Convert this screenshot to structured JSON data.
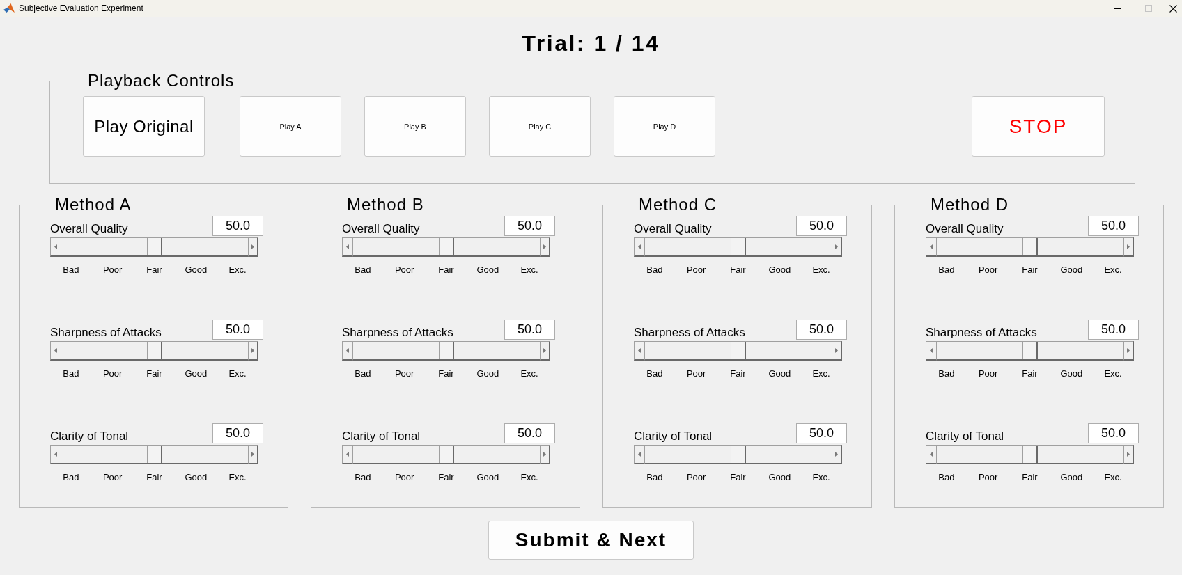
{
  "window": {
    "title": "Subjective Evaluation Experiment",
    "controls": [
      {
        "kind": "minimize",
        "disabled": false
      },
      {
        "kind": "maximize",
        "disabled": true
      },
      {
        "kind": "close",
        "disabled": false
      }
    ]
  },
  "trial_heading": "Trial: 1 / 14",
  "playback_controls": {
    "title": "Playback Controls",
    "buttons": [
      {
        "label": "Play Original",
        "kind": "large"
      },
      {
        "label": "Play A",
        "kind": "small"
      },
      {
        "label": "Play B",
        "kind": "small"
      },
      {
        "label": "Play C",
        "kind": "small"
      },
      {
        "label": "Play D",
        "kind": "small"
      },
      {
        "label": "STOP",
        "kind": "stop"
      }
    ]
  },
  "methods": [
    {
      "title": "Method A",
      "criteria": [
        {
          "label": "Overall Quality",
          "value": "50.0",
          "level": 0.5,
          "scale": [
            "Bad",
            "Poor",
            "Fair",
            "Good",
            "Exc."
          ]
        },
        {
          "label": "Sharpness of Attacks",
          "value": "50.0",
          "level": 0.5,
          "scale": [
            "Bad",
            "Poor",
            "Fair",
            "Good",
            "Exc."
          ]
        },
        {
          "label": "Clarity of Tonal",
          "value": "50.0",
          "level": 0.5,
          "scale": [
            "Bad",
            "Poor",
            "Fair",
            "Good",
            "Exc."
          ]
        }
      ]
    },
    {
      "title": "Method B",
      "criteria": [
        {
          "label": "Overall Quality",
          "value": "50.0",
          "level": 0.5,
          "scale": [
            "Bad",
            "Poor",
            "Fair",
            "Good",
            "Exc."
          ]
        },
        {
          "label": "Sharpness of Attacks",
          "value": "50.0",
          "level": 0.5,
          "scale": [
            "Bad",
            "Poor",
            "Fair",
            "Good",
            "Exc."
          ]
        },
        {
          "label": "Clarity of Tonal",
          "value": "50.0",
          "level": 0.5,
          "scale": [
            "Bad",
            "Poor",
            "Fair",
            "Good",
            "Exc."
          ]
        }
      ]
    },
    {
      "title": "Method C",
      "criteria": [
        {
          "label": "Overall Quality",
          "value": "50.0",
          "level": 0.5,
          "scale": [
            "Bad",
            "Poor",
            "Fair",
            "Good",
            "Exc."
          ]
        },
        {
          "label": "Sharpness of Attacks",
          "value": "50.0",
          "level": 0.5,
          "scale": [
            "Bad",
            "Poor",
            "Fair",
            "Good",
            "Exc."
          ]
        },
        {
          "label": "Clarity of Tonal",
          "value": "50.0",
          "level": 0.5,
          "scale": [
            "Bad",
            "Poor",
            "Fair",
            "Good",
            "Exc."
          ]
        }
      ]
    },
    {
      "title": "Method D",
      "criteria": [
        {
          "label": "Overall Quality",
          "value": "50.0",
          "level": 0.5,
          "scale": [
            "Bad",
            "Poor",
            "Fair",
            "Good",
            "Exc."
          ]
        },
        {
          "label": "Sharpness of Attacks",
          "value": "50.0",
          "level": 0.5,
          "scale": [
            "Bad",
            "Poor",
            "Fair",
            "Good",
            "Exc."
          ]
        },
        {
          "label": "Clarity of Tonal",
          "value": "50.0",
          "level": 0.5,
          "scale": [
            "Bad",
            "Poor",
            "Fair",
            "Good",
            "Exc."
          ]
        }
      ]
    }
  ],
  "submit_button": {
    "label": "Submit & Next"
  }
}
